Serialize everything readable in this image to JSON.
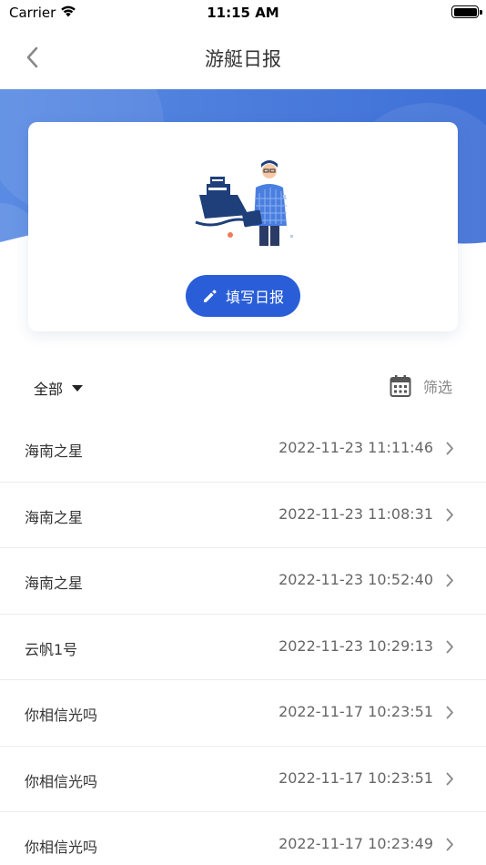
{
  "status_bar": {
    "carrier": "Carrier",
    "time": "11:15 AM"
  },
  "nav": {
    "title": "游艇日报"
  },
  "card": {
    "button_label": "填写日报"
  },
  "filters": {
    "category": "全部",
    "date_filter_label": "筛选"
  },
  "colors": {
    "primary": "#2a5ed8",
    "header_gradient_start": "#5a8be3",
    "header_gradient_end": "#3e6fd6"
  },
  "reports": [
    {
      "name": "海南之星",
      "time": "2022-11-23 11:11:46"
    },
    {
      "name": "海南之星",
      "time": "2022-11-23 11:08:31"
    },
    {
      "name": "海南之星",
      "time": "2022-11-23 10:52:40"
    },
    {
      "name": "云帆1号",
      "time": "2022-11-23 10:29:13"
    },
    {
      "name": "你相信光吗",
      "time": "2022-11-17 10:23:51"
    },
    {
      "name": "你相信光吗",
      "time": "2022-11-17 10:23:51"
    },
    {
      "name": "你相信光吗",
      "time": "2022-11-17 10:23:49"
    }
  ]
}
